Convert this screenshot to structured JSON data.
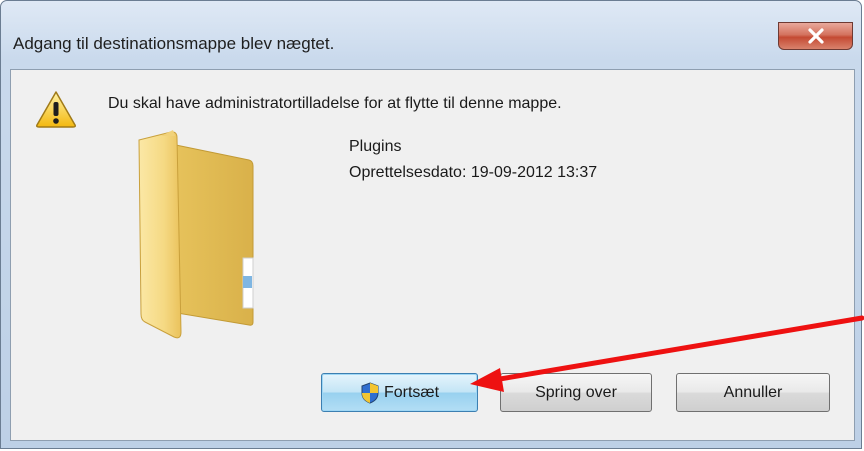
{
  "dialog": {
    "title": "Adgang til destinationsmappe blev nægtet.",
    "close_label": "X",
    "message": "Du skal have administratortilladelse for at flytte til denne mappe.",
    "item": {
      "name": "Plugins",
      "created": "Oprettelsesdato: 19-09-2012 13:37"
    },
    "buttons": {
      "continue_label": "Fortsæt",
      "skip_label": "Spring over",
      "cancel_label": "Annuller"
    }
  },
  "annotation": {
    "arrow_color": "#ee1111"
  },
  "icons": {
    "warning": "warning-icon",
    "folder": "folder-icon",
    "uac_shield": "uac-shield-icon"
  }
}
